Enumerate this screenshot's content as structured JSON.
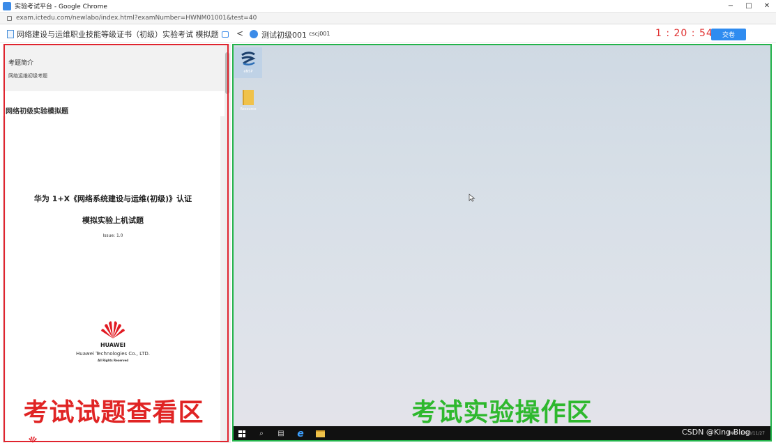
{
  "window": {
    "title": "实验考试平台 - Google Chrome",
    "controls": {
      "minimize": "−",
      "maximize": "□",
      "close": "✕"
    }
  },
  "address_bar": {
    "url": "exam.ictedu.com/newlabo/index.html?examNumber=HWNM01001&test=40"
  },
  "exam_header": {
    "title": "网络建设与运维职业技能等级证书（初级）实验考试 模拟题",
    "back": "<",
    "lab_name": "测试初级001",
    "lab_code": "cscj001",
    "timer": "1 : 20 : 54",
    "submit_label": "交卷"
  },
  "left_pane": {
    "intro_heading": "考题简介",
    "intro_text": "网络运维初级考题",
    "section_title": "网络初级实验模拟题",
    "document": {
      "line1": "华为 1+X《网络系统建设与运维(初级)》认证",
      "line2": "模拟实验上机试题",
      "issue": "Issue: 1.0",
      "company_logo": "HUAWEI",
      "company": "Huawei Technologies Co., LTD.",
      "rights": "All Rights Reserved"
    },
    "caption": "考试试题查看区"
  },
  "right_pane": {
    "desktop_icons": [
      {
        "label": "eNSP",
        "icon": "ensp-icon"
      },
      {
        "label": "Resource",
        "icon": "folder-icon"
      }
    ],
    "caption": "考试实验操作区",
    "taskbar": {
      "items": [
        "start-icon",
        "search-icon",
        "task-view-icon",
        "ie-icon",
        "file-explorer-icon"
      ],
      "language": "ENG",
      "date": "2020/11/27"
    }
  },
  "watermark": "CSDN @King Blog",
  "colors": {
    "left_frame": "#e0242e",
    "right_frame": "#22b34a",
    "timer": "#e03030",
    "submit": "#2f8cf0",
    "left_caption": "#e02424",
    "right_caption": "#2eb82e"
  }
}
